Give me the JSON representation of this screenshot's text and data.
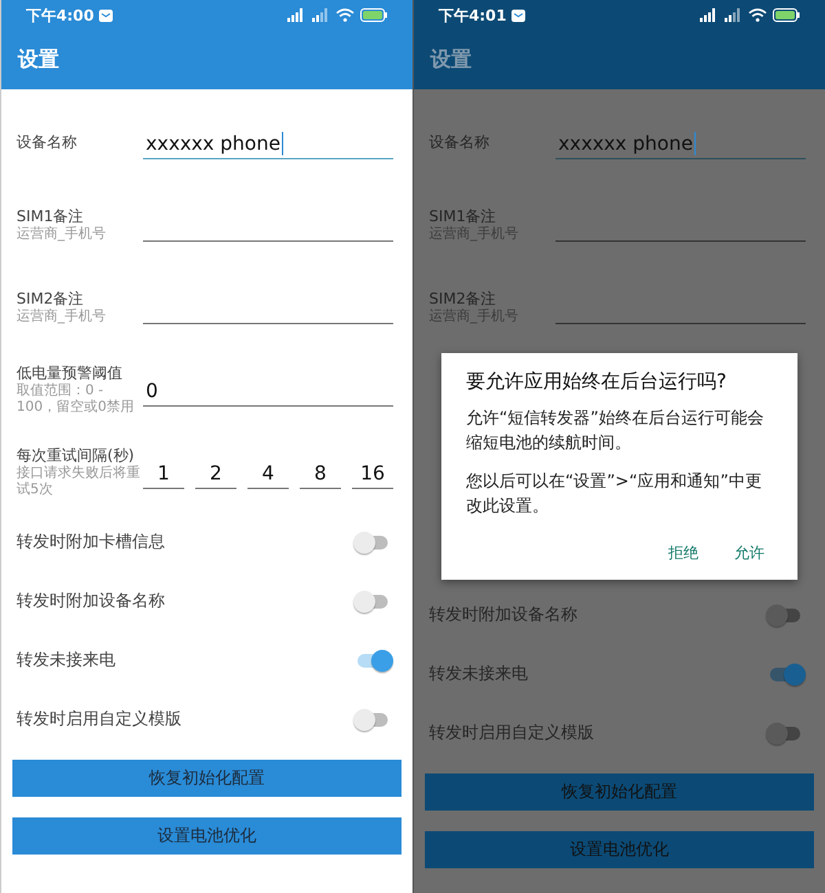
{
  "screens": [
    {
      "dimmed": false,
      "status_bar": {
        "time": "下午4:00"
      },
      "title": "设置",
      "rows": [
        {
          "kind": "text_field",
          "label": "设备名称",
          "value": "xxxxxx phone",
          "focused": true
        },
        {
          "kind": "text_field",
          "label": "SIM1备注",
          "hint": "运营商_手机号",
          "focused": false
        },
        {
          "kind": "text_field",
          "label": "SIM2备注",
          "hint": "运营商_手机号",
          "focused": false
        },
        {
          "kind": "text_field",
          "label": "低电量预警阈值",
          "hint": "取值范围：0 - 100，留空或0禁用",
          "value": "0",
          "focused": false
        },
        {
          "kind": "retry",
          "label": "每次重试间隔(秒)",
          "hint": "接口请求失败后将重试5次",
          "values": [
            "1",
            "2",
            "4",
            "8",
            "16"
          ]
        },
        {
          "kind": "switch",
          "label": "转发时附加卡槽信息",
          "on": false
        },
        {
          "kind": "switch",
          "label": "转发时附加设备名称",
          "on": false
        },
        {
          "kind": "switch",
          "label": "转发未接来电",
          "on": true
        },
        {
          "kind": "switch",
          "label": "转发时启用自定义模版",
          "on": false
        }
      ],
      "buttons": [
        "恢复初始化配置",
        "设置电池优化"
      ]
    },
    {
      "dimmed": true,
      "status_bar": {
        "time": "下午4:01"
      },
      "title": "设置",
      "rows": [
        {
          "kind": "text_field",
          "label": "设备名称",
          "value": "xxxxxx phone",
          "focused": true
        },
        {
          "kind": "text_field",
          "label": "SIM1备注",
          "hint": "运营商_手机号",
          "focused": false
        },
        {
          "kind": "text_field",
          "label": "SIM2备注",
          "hint": "运营商_手机号",
          "focused": false
        },
        {
          "kind": "dialog",
          "title": "要允许应用始终在后台运行吗?",
          "paragraphs": [
            "允许“短信转发器”始终在后台运行可能会缩短电池的续航时间。",
            "您以后可以在“设置”>“应用和通知”中更改此设置。"
          ],
          "actions": [
            "拒绝",
            "允许"
          ]
        },
        {
          "kind": "switch",
          "label": "转发时附加设备名称",
          "on": false
        },
        {
          "kind": "switch",
          "label": "转发未接来电",
          "on": true
        },
        {
          "kind": "switch",
          "label": "转发时启用自定义模版",
          "on": false
        }
      ],
      "buttons": [
        "恢复初始化配置",
        "设置电池优化"
      ]
    }
  ]
}
